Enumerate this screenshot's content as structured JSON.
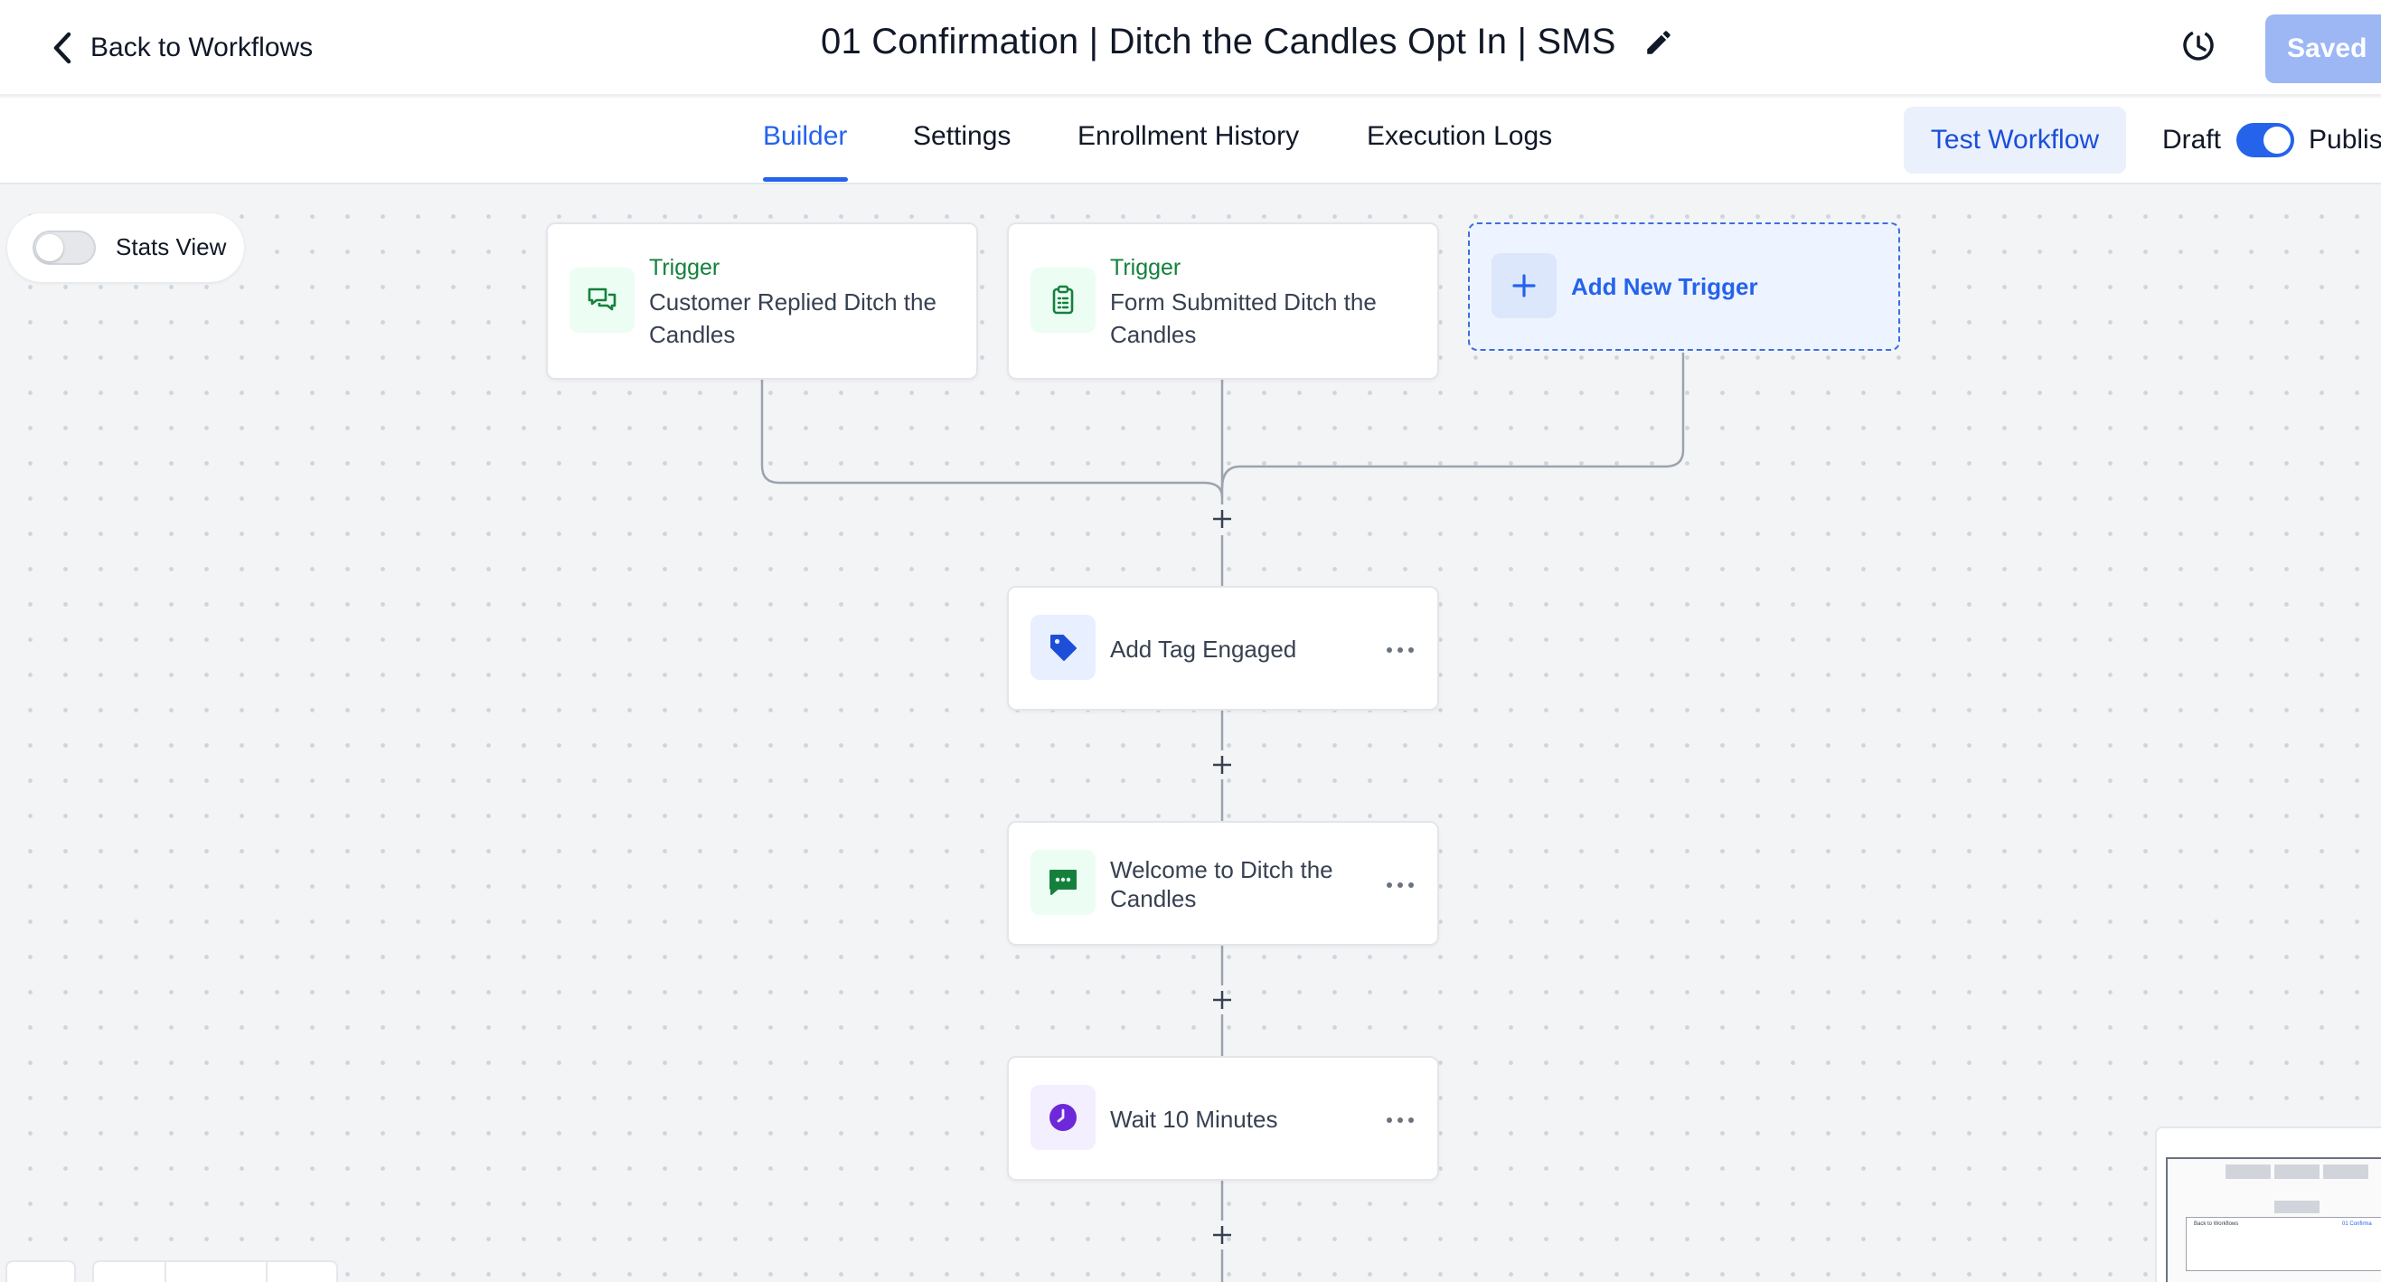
{
  "header": {
    "back_label": "Back to Workflows",
    "title": "01 Confirmation | Ditch the Candles Opt In | SMS",
    "saved_label": "Saved",
    "history_icon": "history-icon",
    "edit_icon": "pencil-icon"
  },
  "tabs": [
    {
      "label": "Builder",
      "active": true
    },
    {
      "label": "Settings",
      "active": false
    },
    {
      "label": "Enrollment History",
      "active": false
    },
    {
      "label": "Execution Logs",
      "active": false
    }
  ],
  "toolbar": {
    "test_label": "Test Workflow",
    "draft_label": "Draft",
    "publish_label": "Publish",
    "published": true
  },
  "stats_view": {
    "label": "Stats View",
    "enabled": false
  },
  "triggers": [
    {
      "type_label": "Trigger",
      "text": "Customer Replied Ditch the Candles",
      "icon": "chat-bubbles-icon"
    },
    {
      "type_label": "Trigger",
      "text": "Form Submitted Ditch the Candles",
      "icon": "clipboard-icon"
    }
  ],
  "add_trigger_label": "Add New Trigger",
  "actions": [
    {
      "text": "Add Tag Engaged",
      "icon": "tag-icon"
    },
    {
      "text": "Welcome to Ditch the Candles",
      "icon": "sms-icon"
    },
    {
      "text": "Wait 10 Minutes",
      "icon": "clock-icon"
    }
  ],
  "minimap": {
    "title_fragment": "01 Confirma",
    "back_fragment": "Back to Workflows"
  },
  "colors": {
    "accent": "#2563eb",
    "trigger_green": "#15803d",
    "tag_blue": "#1d4ed8",
    "sms_green": "#15803d",
    "wait_purple": "#6d28d9",
    "saved_button": "#9db7f5"
  }
}
